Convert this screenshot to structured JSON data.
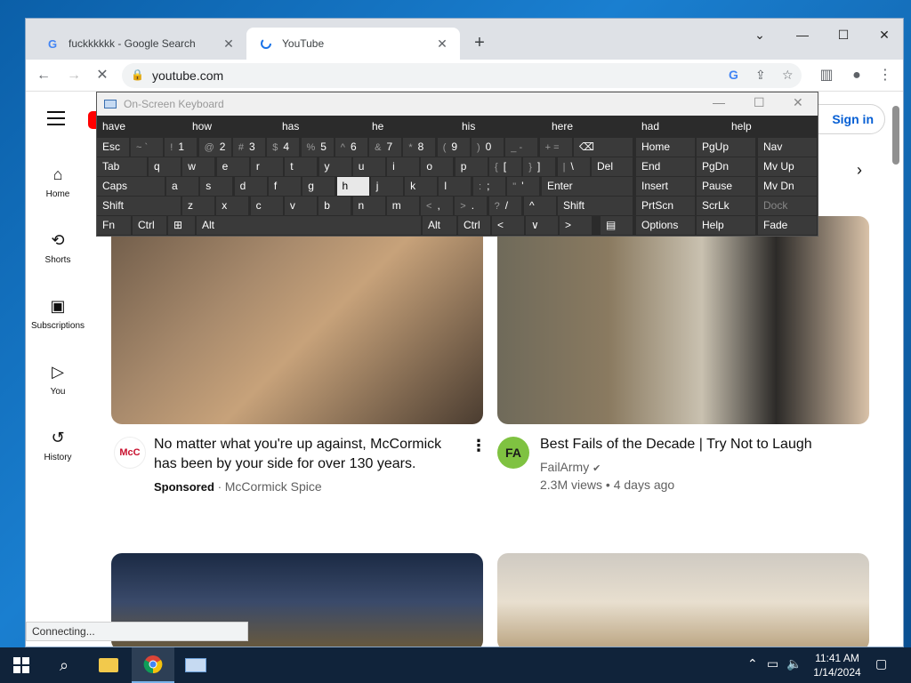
{
  "browser": {
    "tabs": [
      {
        "title": "fuckkkkkk - Google Search",
        "favicon": "G",
        "active": false
      },
      {
        "title": "YouTube",
        "favicon": "loading-spinner",
        "active": true
      }
    ],
    "new_tab": "+",
    "window_controls": {
      "dropdown": "⌄",
      "minimize": "—",
      "maximize": "☐",
      "close": "✕"
    },
    "toolbar": {
      "back": "←",
      "forward": "→",
      "stop": "✕",
      "url": "youtube.com"
    },
    "status_text": "Connecting..."
  },
  "youtube": {
    "sign_in": "Sign in",
    "sidebar": [
      {
        "label": "Home",
        "icon": "home-icon"
      },
      {
        "label": "Shorts",
        "icon": "shorts-icon"
      },
      {
        "label": "Subscriptions",
        "icon": "subscriptions-icon"
      },
      {
        "label": "You",
        "icon": "you-icon"
      },
      {
        "label": "History",
        "icon": "history-icon"
      }
    ],
    "videos": [
      {
        "title_line1": "No matter what you're up against, McCormick",
        "title_line2": "has been by your side for over 130 years.",
        "sponsored": "Sponsored",
        "channel": "McCormick Spice",
        "avatar": "McC"
      },
      {
        "title_line1": "Best Fails of the Decade | Try Not to Laugh",
        "channel": "FailArmy",
        "meta": "2.3M views • 4 days ago",
        "avatar": "FA"
      }
    ]
  },
  "osk": {
    "title": "On-Screen Keyboard",
    "predictions": [
      "have",
      "how",
      "has",
      "he",
      "his",
      "here",
      "had",
      "help"
    ],
    "row1": {
      "esc": "Esc",
      "keys": [
        [
          "~ `",
          ""
        ],
        [
          "!",
          "1"
        ],
        [
          "@",
          "2"
        ],
        [
          "#",
          "3"
        ],
        [
          "$",
          "4"
        ],
        [
          "%",
          "5"
        ],
        [
          "^",
          "6"
        ],
        [
          "&",
          "7"
        ],
        [
          "*",
          "8"
        ],
        [
          "(",
          "9"
        ],
        [
          ")",
          "0"
        ],
        [
          "_ -",
          ""
        ],
        [
          "+ =",
          ""
        ]
      ],
      "back": "⌫"
    },
    "row2": {
      "tab": "Tab",
      "keys": [
        "q",
        "w",
        "e",
        "r",
        "t",
        "y",
        "u",
        "i",
        "o",
        "p"
      ],
      "extra": [
        [
          "{",
          "["
        ],
        [
          "}",
          "]"
        ],
        [
          "|",
          "\\"
        ]
      ],
      "del": "Del"
    },
    "row3": {
      "caps": "Caps",
      "keys": [
        "a",
        "s",
        "d",
        "f",
        "g",
        "h",
        "j",
        "k",
        "l"
      ],
      "extra": [
        [
          ":",
          ";"
        ],
        [
          "\"",
          "'"
        ]
      ],
      "enter": "Enter"
    },
    "row4": {
      "shift": "Shift",
      "keys": [
        "z",
        "x",
        "c",
        "v",
        "b",
        "n",
        "m"
      ],
      "extra": [
        [
          "<",
          ","
        ],
        [
          ">",
          "."
        ],
        [
          "?",
          "/"
        ]
      ],
      "up": "^",
      "shift_r": "Shift"
    },
    "row5": {
      "fn": "Fn",
      "ctrl": "Ctrl",
      "win": "⊞",
      "alt": "Alt",
      "alt_r": "Alt",
      "ctrl_r": "Ctrl",
      "left": "<",
      "down": "∨",
      "right": ">",
      "menu": "▤"
    },
    "nav": [
      [
        "Home",
        "PgUp",
        "Nav"
      ],
      [
        "End",
        "PgDn",
        "Mv Up"
      ],
      [
        "Insert",
        "Pause",
        "Mv Dn"
      ],
      [
        "PrtScn",
        "ScrLk",
        "Dock"
      ],
      [
        "Options",
        "Help",
        "Fade"
      ]
    ]
  },
  "taskbar": {
    "time": "11:41 AM",
    "date": "1/14/2024"
  }
}
